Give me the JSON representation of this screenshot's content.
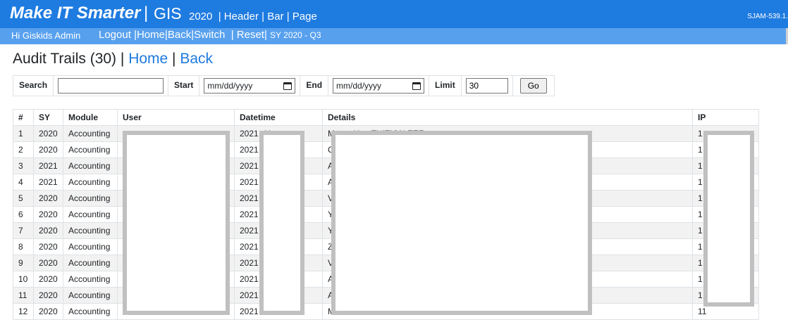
{
  "header": {
    "brand": "Make IT Smarter",
    "separator": "|",
    "app": "GIS",
    "year": "2020",
    "links": [
      "Header",
      "Bar",
      "Page"
    ],
    "version": "SJAM-539.1."
  },
  "subbar": {
    "greeting": "Hi Giskids Admin",
    "links": [
      "Logout",
      "Home",
      "Back",
      "Switch",
      "Reset"
    ],
    "term": "SY 2020 - Q3"
  },
  "page": {
    "title": "Audit Trails (30)",
    "home_link": "Home",
    "back_link": "Back"
  },
  "filters": {
    "search_label": "Search",
    "search_value": "",
    "start_label": "Start",
    "start_placeholder": "mm/dd/yyyy",
    "end_label": "End",
    "end_placeholder": "mm/dd/yyyy",
    "limit_label": "Limit",
    "limit_value": "30",
    "go_label": "Go"
  },
  "table": {
    "columns": [
      "#",
      "SY",
      "Module",
      "User",
      "Datetime",
      "Details",
      "IP"
    ],
    "rows": [
      {
        "num": "1",
        "sy": "2020",
        "module": "Accounting",
        "user": "",
        "datetime": "2021 :11",
        "details": "M   ...   tuition TUITION FEE.",
        "ip": "1"
      },
      {
        "num": "2",
        "sy": "2020",
        "module": "Accounting",
        "user": "",
        "datetime": "2021 :55",
        "details": "C   ...   US BALANCE.",
        "ip": "1"
      },
      {
        "num": "3",
        "sy": "2021",
        "module": "Accounting",
        "user": "",
        "datetime": "2021 :30",
        "details": "A   ...   N FEE.",
        "ip": "1"
      },
      {
        "num": "4",
        "sy": "2021",
        "module": "Accounting",
        "user": "",
        "datetime": "2021 :32",
        "details": "A   ...   ATION FEE.",
        "ip": "1"
      },
      {
        "num": "5",
        "sy": "2020",
        "module": "Accounting",
        "user": "",
        "datetime": "2021 :07",
        "details": "V",
        "ip": "1"
      },
      {
        "num": "6",
        "sy": "2020",
        "module": "Accounting",
        "user": "",
        "datetime": "2021 :58",
        "details": "Y   ...   OMPLETION.",
        "ip": "1"
      },
      {
        "num": "7",
        "sy": "2020",
        "module": "Accounting",
        "user": "",
        "datetime": "2021 :43",
        "details": "Y   ...   RECORD FORM 137.",
        "ip": "1"
      },
      {
        "num": "8",
        "sy": "2020",
        "module": "Accounting",
        "user": "",
        "datetime": "2021 :13",
        "details": "Z   ...   IT PROGRAM.",
        "ip": "1"
      },
      {
        "num": "9",
        "sy": "2020",
        "module": "Accounting",
        "user": "",
        "datetime": "2021 :19",
        "details": "V   ...   TION FEE.",
        "ip": "1"
      },
      {
        "num": "10",
        "sy": "2020",
        "module": "Accounting",
        "user": "",
        "datetime": "2021 :41",
        "details": "A",
        "ip": "1"
      },
      {
        "num": "11",
        "sy": "2020",
        "module": "Accounting",
        "user": "",
        "datetime": "2021 :09",
        "details": "A   ...   I FEE.",
        "ip": "1"
      },
      {
        "num": "12",
        "sy": "2020",
        "module": "Accounting",
        "user": "",
        "datetime": "2021 :10",
        "details": "M   ...   for TUITION FEE.",
        "ip": "11"
      }
    ]
  }
}
